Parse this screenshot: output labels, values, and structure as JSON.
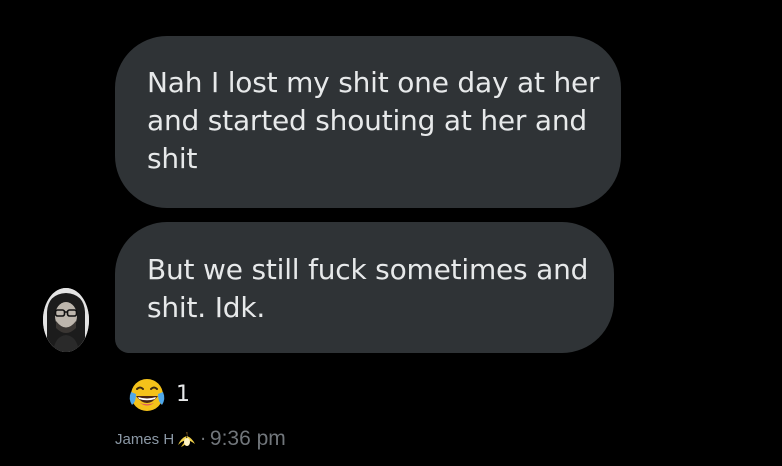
{
  "messages": [
    {
      "lines": [
        "Nah I lost my shit one day at her",
        "and started shouting at her and",
        "shit"
      ]
    },
    {
      "lines": [
        "But we still fuck sometimes and",
        "shit. Idk."
      ]
    }
  ],
  "reaction": {
    "emoji": "face-with-tears-of-joy-icon",
    "count": "1"
  },
  "meta": {
    "sender": "James H",
    "sender_emoji": "banana-peel-icon",
    "separator": "·",
    "time": "9:36 pm"
  },
  "colors": {
    "background": "#000000",
    "bubble": "#2f3336",
    "text": "#e7e9ea",
    "muted": "#71767b"
  }
}
